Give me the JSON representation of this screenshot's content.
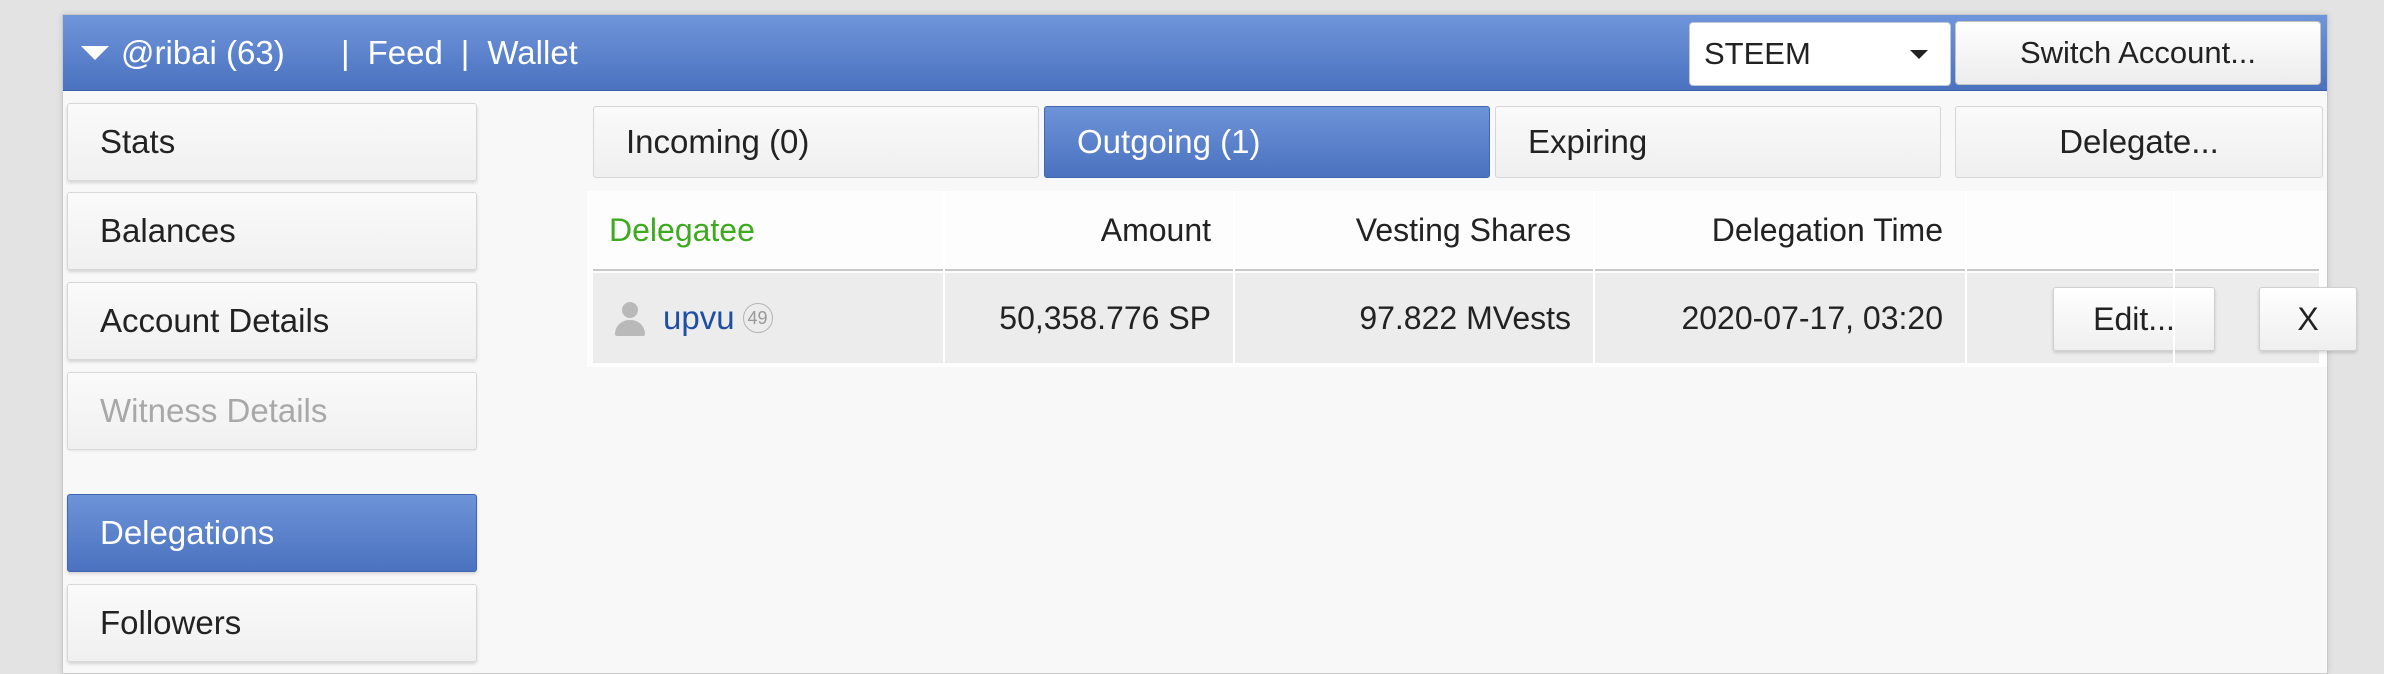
{
  "header": {
    "account_label": "@ribai (63)",
    "separator": "|",
    "nav": [
      "Feed",
      "Wallet"
    ],
    "coin_select": {
      "selected": "STEEM"
    },
    "switch_account_label": "Switch Account..."
  },
  "sidebar": {
    "items": [
      {
        "label": "Stats"
      },
      {
        "label": "Balances"
      },
      {
        "label": "Account Details"
      },
      {
        "label": "Witness Details",
        "disabled": true
      },
      {
        "label": "Delegations",
        "active": true
      },
      {
        "label": "Followers"
      }
    ]
  },
  "tabs": [
    {
      "label": "Incoming (0)"
    },
    {
      "label": "Outgoing (1)",
      "active": true
    },
    {
      "label": "Expiring"
    },
    {
      "label": "Delegate..."
    }
  ],
  "table": {
    "columns": [
      "Delegatee",
      "Amount",
      "Vesting Shares",
      "Delegation Time"
    ],
    "rows": [
      {
        "delegatee": "upvu",
        "reputation": "49",
        "amount": "50,358.776 SP",
        "vesting_shares": "97.822 MVests",
        "delegation_time": "2020-07-17, 03:20",
        "edit_label": "Edit...",
        "remove_label": "X"
      }
    ]
  },
  "colors": {
    "accent_blue": "#5580cc",
    "delegatee_header_green": "#3daa1f",
    "user_link_blue": "#1f4fa3"
  }
}
